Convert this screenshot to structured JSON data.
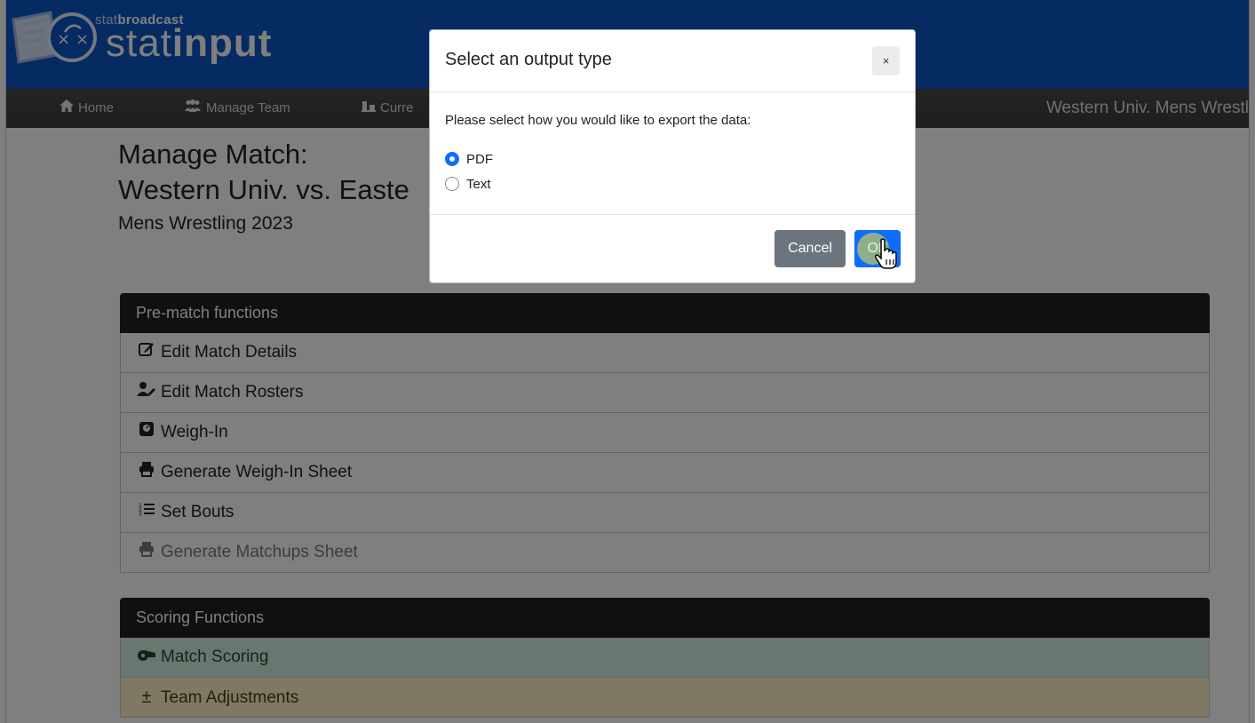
{
  "brand": {
    "small_prefix": "stat",
    "small_bold": "broadcast",
    "big_prefix": "stat",
    "big_bold": "input"
  },
  "nav": {
    "items": [
      {
        "label": "Home",
        "icon": "home-icon"
      },
      {
        "label": "Manage Team",
        "icon": "team-icon"
      },
      {
        "label": "Curre",
        "icon": "current-icon"
      }
    ],
    "right_text": "Western Univ. Mens Wrestl"
  },
  "page": {
    "title_line1": "Manage Match:",
    "title_line2": "Western Univ. vs. Easte",
    "subtitle": "Mens Wrestling 2023"
  },
  "prematch": {
    "header": "Pre-match functions",
    "rows": [
      {
        "label": "Edit Match Details",
        "icon": "edit-icon"
      },
      {
        "label": "Edit Match Rosters",
        "icon": "user-edit-icon"
      },
      {
        "label": "Weigh-In",
        "icon": "scale-icon"
      },
      {
        "label": "Generate Weigh-In Sheet",
        "icon": "print-icon"
      },
      {
        "label": "Set Bouts",
        "icon": "numbered-list-icon"
      },
      {
        "label": "Generate Matchups Sheet",
        "icon": "print-icon"
      }
    ]
  },
  "scoring": {
    "header": "Scoring Functions",
    "rows": [
      {
        "label": "Match Scoring",
        "icon": "whistle-icon"
      },
      {
        "label": "Team Adjustments",
        "icon": "plus-minus-icon"
      }
    ]
  },
  "modal": {
    "title": "Select an output type",
    "close_label": "×",
    "prompt": "Please select how you would like to export the data:",
    "options": [
      {
        "label": "PDF",
        "selected": true
      },
      {
        "label": "Text",
        "selected": false
      }
    ],
    "cancel_label": "Cancel",
    "ok_label": "OK"
  },
  "colors": {
    "header_blue": "#0b56c4",
    "primary": "#0d6efd",
    "secondary": "#6c757d",
    "dark": "#202124"
  }
}
